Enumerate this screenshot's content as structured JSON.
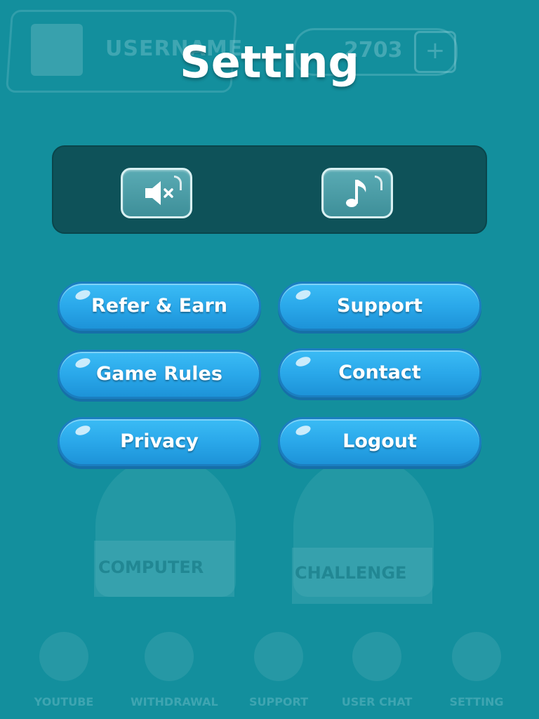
{
  "background": {
    "username": "USERNAME",
    "coins": "2703",
    "plus": "+",
    "modes": [
      "COMPUTER",
      "CHALLENGE"
    ],
    "nav": [
      "YOUTUBE",
      "WITHDRAWAL",
      "SUPPORT",
      "USER CHAT",
      "SETTING"
    ]
  },
  "title": "Setting",
  "sound": {
    "mute_icon": "speaker-mute-icon",
    "music_icon": "music-note-icon"
  },
  "menu": {
    "refer": "Refer & Earn",
    "support": "Support",
    "rules": "Game Rules",
    "contact": "Contact",
    "privacy": "Privacy",
    "logout": "Logout"
  },
  "colors": {
    "overlay": "#138f9d",
    "panel": "#0e5259",
    "button": "#2aa8ea"
  }
}
